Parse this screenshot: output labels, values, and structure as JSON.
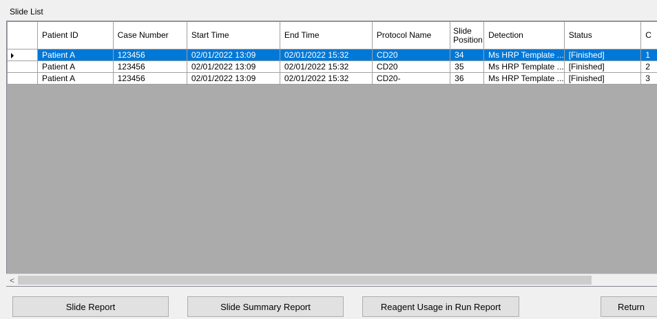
{
  "groupbox": {
    "title": "Slide List"
  },
  "grid": {
    "columns": [
      "Patient ID",
      "Case Number",
      "Start Time",
      "End Time",
      "Protocol Name",
      "Slide Position",
      "Detection",
      "Status",
      "C"
    ],
    "rows": [
      [
        "Patient A",
        "123456",
        "02/01/2022 13:09",
        "02/01/2022 15:32",
        "CD20",
        "34",
        "Ms HRP Template ...",
        "[Finished]",
        "1"
      ],
      [
        "Patient A",
        "123456",
        "02/01/2022 13:09",
        "02/01/2022 15:32",
        "CD20",
        "35",
        "Ms HRP Template ...",
        "[Finished]",
        "2"
      ],
      [
        "Patient A",
        "123456",
        "02/01/2022 13:09",
        "02/01/2022 15:32",
        "CD20-",
        "36",
        "Ms HRP Template ...",
        "[Finished]",
        "3"
      ]
    ],
    "selected_row": 0
  },
  "scrollbar": {
    "left_arrow": "<"
  },
  "buttons": {
    "slide_report": "Slide Report",
    "slide_summary_report": "Slide Summary Report",
    "reagent_usage": "Reagent Usage in Run Report",
    "return": "Return"
  }
}
